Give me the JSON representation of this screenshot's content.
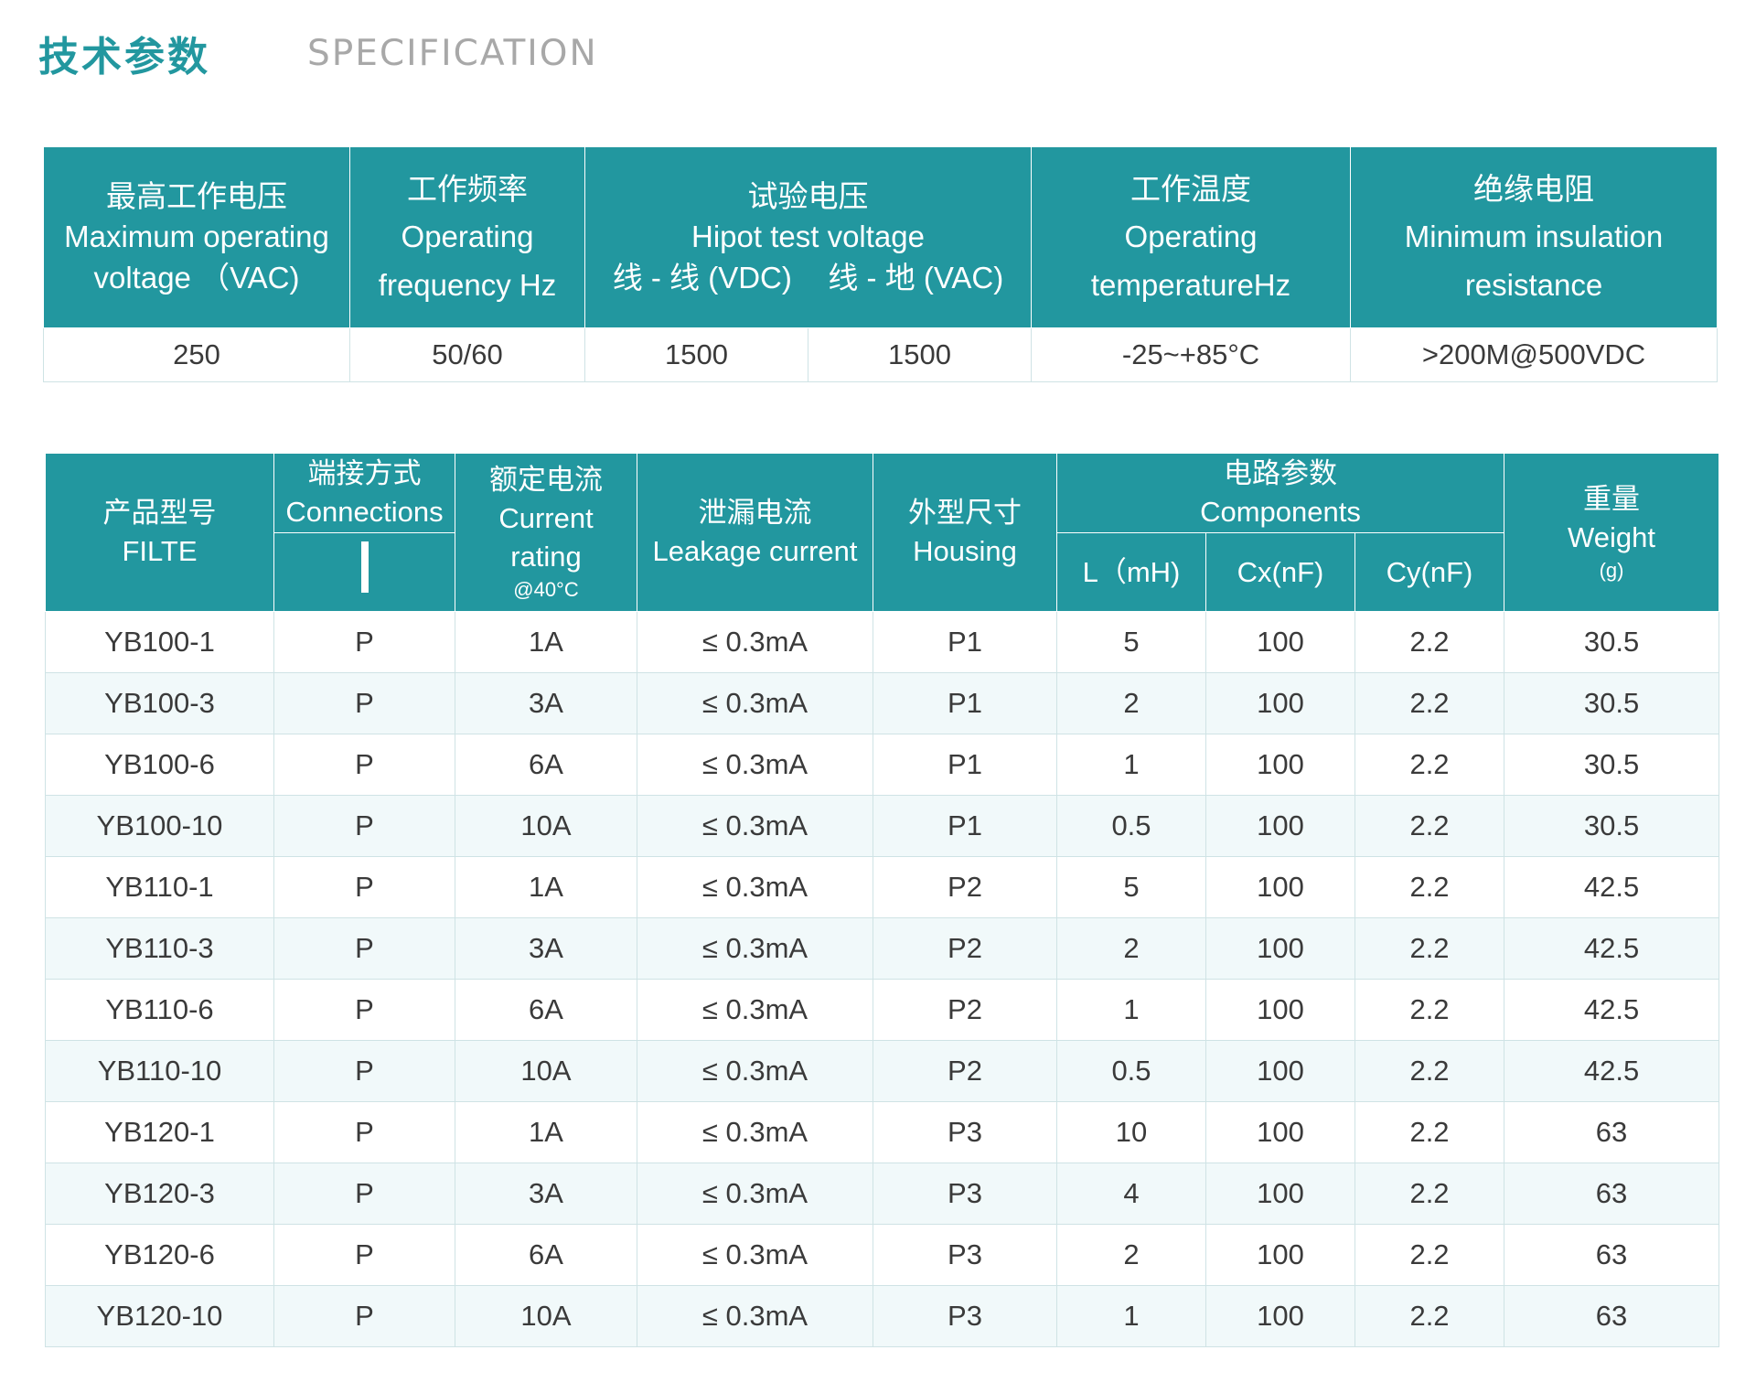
{
  "title_cn": "技术参数",
  "title_en": "SPECIFICATION",
  "spec": {
    "headers": [
      {
        "cn": "最高工作电压",
        "en": "Maximum operating",
        "en2": "voltage （VAC)"
      },
      {
        "cn": "工作频率",
        "en": "Operating",
        "en2": "frequency Hz"
      },
      {
        "cn": "试验电压",
        "en": "Hipot test voltage",
        "sub1": "线 - 线 (VDC)",
        "sub2": "线 - 地 (VAC)"
      },
      {
        "cn": "工作温度",
        "en": "Operating",
        "en2": "temperatureHz"
      },
      {
        "cn": "绝缘电阻",
        "en": "Minimum insulation",
        "en2": "resistance"
      }
    ],
    "values": [
      "250",
      "50/60",
      "1500",
      "1500",
      "-25~+85°C",
      ">200M@500VDC"
    ]
  },
  "products": {
    "headers": {
      "model": {
        "cn": "产品型号",
        "en": "FILTE"
      },
      "connections": {
        "cn": "端接方式",
        "en": "Connections"
      },
      "current": {
        "cn": "额定电流",
        "en": "Current",
        "en2": "rating",
        "note": "@40°C"
      },
      "leakage": {
        "cn": "泄漏电流",
        "en": "Leakage current"
      },
      "housing": {
        "cn": "外型尺寸",
        "en": "Housing"
      },
      "components": {
        "cn": "电路参数",
        "en": "Components",
        "l": "L（mH)",
        "cx": "Cx(nF)",
        "cy": "Cy(nF)"
      },
      "weight": {
        "cn": "重量",
        "en": "Weight",
        "unit": "(g)"
      }
    },
    "rows": [
      [
        "YB100-1",
        "P",
        "1A",
        "≤ 0.3mA",
        "P1",
        "5",
        "100",
        "2.2",
        "30.5"
      ],
      [
        "YB100-3",
        "P",
        "3A",
        "≤ 0.3mA",
        "P1",
        "2",
        "100",
        "2.2",
        "30.5"
      ],
      [
        "YB100-6",
        "P",
        "6A",
        "≤ 0.3mA",
        "P1",
        "1",
        "100",
        "2.2",
        "30.5"
      ],
      [
        "YB100-10",
        "P",
        "10A",
        "≤ 0.3mA",
        "P1",
        "0.5",
        "100",
        "2.2",
        "30.5"
      ],
      [
        "YB110-1",
        "P",
        "1A",
        "≤ 0.3mA",
        "P2",
        "5",
        "100",
        "2.2",
        "42.5"
      ],
      [
        "YB110-3",
        "P",
        "3A",
        "≤ 0.3mA",
        "P2",
        "2",
        "100",
        "2.2",
        "42.5"
      ],
      [
        "YB110-6",
        "P",
        "6A",
        "≤ 0.3mA",
        "P2",
        "1",
        "100",
        "2.2",
        "42.5"
      ],
      [
        "YB110-10",
        "P",
        "10A",
        "≤ 0.3mA",
        "P2",
        "0.5",
        "100",
        "2.2",
        "42.5"
      ],
      [
        "YB120-1",
        "P",
        "1A",
        "≤ 0.3mA",
        "P3",
        "10",
        "100",
        "2.2",
        "63"
      ],
      [
        "YB120-3",
        "P",
        "3A",
        "≤ 0.3mA",
        "P3",
        "4",
        "100",
        "2.2",
        "63"
      ],
      [
        "YB120-6",
        "P",
        "6A",
        "≤ 0.3mA",
        "P3",
        "2",
        "100",
        "2.2",
        "63"
      ],
      [
        "YB120-10",
        "P",
        "10A",
        "≤ 0.3mA",
        "P3",
        "1",
        "100",
        "2.2",
        "63"
      ]
    ]
  }
}
